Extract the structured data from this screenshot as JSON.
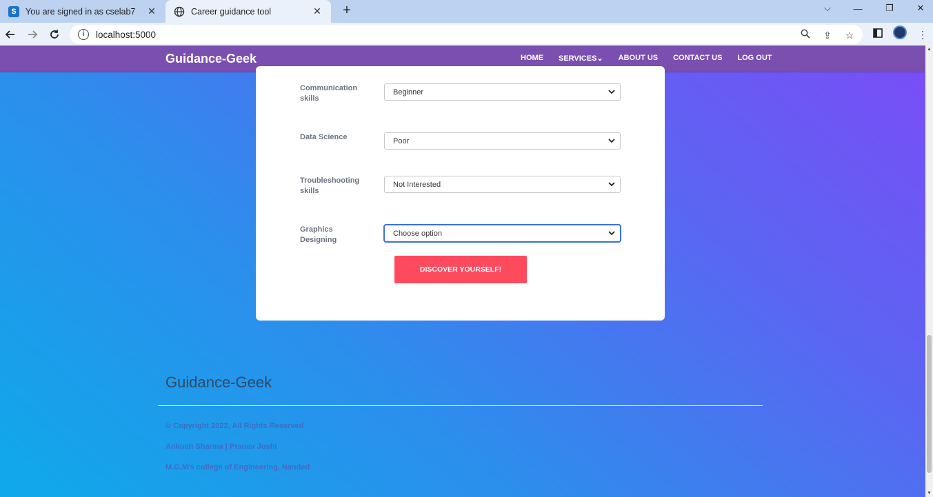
{
  "browser": {
    "tabs": [
      {
        "title": "You are signed in as cselab7",
        "favicon": "S"
      },
      {
        "title": "Career guidance tool"
      }
    ],
    "url": "localhost:5000"
  },
  "site": {
    "brand": "Guidance-Geek",
    "nav": [
      "HOME",
      "SERVICES⌄",
      "ABOUT US",
      "CONTACT US",
      "LOG OUT"
    ]
  },
  "form": {
    "fields": [
      {
        "label": "Communication skills",
        "value": "Beginner"
      },
      {
        "label": "Data Science",
        "value": "Poor"
      },
      {
        "label": "Troubleshooting skills",
        "value": "Not Interested"
      },
      {
        "label": "Graphics Designing",
        "value": "Choose option"
      }
    ],
    "submit_label": "DISCOVER YOURSELF!"
  },
  "footer": {
    "brand": "Guidance-Geek",
    "copyright": "© Copyright 2022, All Rights Reserved",
    "authors": "Ankush Sharma | Pranav Joshi",
    "college": "M.G.M's college of Engineering, Nanded"
  },
  "colors": {
    "nav_bg": "#7b4fb0",
    "button_bg": "#fe4a5d",
    "gradient_start": "#0fa9ea",
    "gradient_end": "#7b4cf7"
  }
}
